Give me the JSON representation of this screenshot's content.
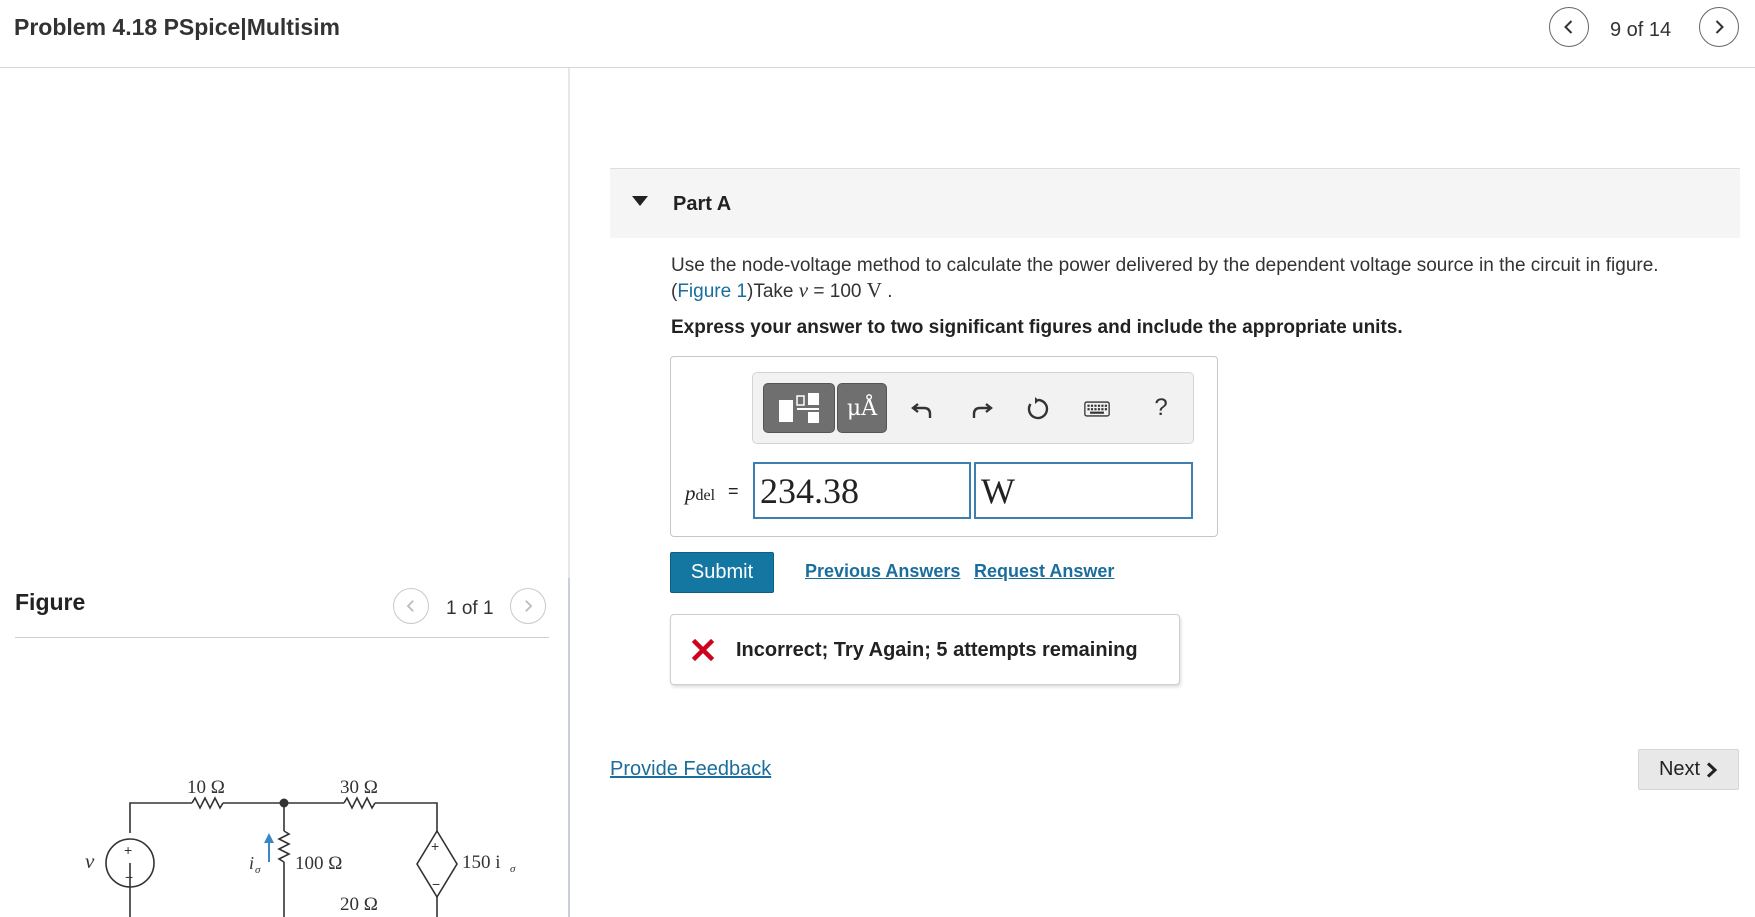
{
  "header": {
    "title": "Problem 4.18 PSpice|Multisim",
    "page_indicator": "9 of 14"
  },
  "figure": {
    "title": "Figure",
    "counter": "1 of 1",
    "labels": {
      "r1": "10 Ω",
      "r2": "30 Ω",
      "r3": "100 Ω",
      "r4": "20 Ω",
      "source_v": "v",
      "current_ig": "i",
      "current_ig_sub": "σ",
      "dep_source": "150 i",
      "dep_source_sub": "σ",
      "plus": "+",
      "minus": "−"
    }
  },
  "part": {
    "label": "Part A",
    "question_main": "Use the node-voltage method to calculate the power delivered by the dependent voltage source in the circuit in figure.",
    "question_open": "(",
    "figure_link": "Figure 1",
    "question_take": ")Take ",
    "var_v": "v",
    "equals_value": " = 100 ",
    "unit_V": "V",
    "period": " .",
    "instruction": "Express your answer to two significant figures and include the appropriate units."
  },
  "answer": {
    "toolbar": {
      "units_label": "μÅ",
      "help_label": "?"
    },
    "variable": "p",
    "variable_sub": "del",
    "equals": "=",
    "value": "234.38",
    "unit": "W"
  },
  "actions": {
    "submit": "Submit",
    "previous_answers": "Previous Answers",
    "request_answer": "Request Answer"
  },
  "feedback": {
    "message": "Incorrect; Try Again; 5 attempts remaining"
  },
  "footer": {
    "provide_feedback": "Provide Feedback",
    "next": "Next"
  },
  "colors": {
    "accent_blue": "#1477a2",
    "link_blue": "#1a6d9c",
    "error_red": "#d0021b",
    "input_border": "#3d7fb0"
  }
}
